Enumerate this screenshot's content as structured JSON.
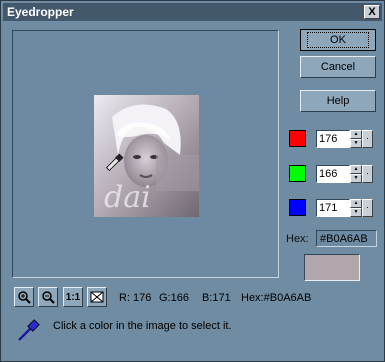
{
  "window": {
    "title": "Eyedropper",
    "close_label": "X"
  },
  "buttons": {
    "ok": "OK",
    "cancel": "Cancel",
    "help": "Help"
  },
  "channels": {
    "red": {
      "value": "176",
      "swatch_color": "#ff0000"
    },
    "green": {
      "value": "166",
      "swatch_color": "#00ff00"
    },
    "blue": {
      "value": "171",
      "swatch_color": "#0000ff"
    }
  },
  "hex": {
    "label": "Hex:",
    "value": "#B0A6AB"
  },
  "selected_color": "#b0a6ab",
  "toolbar": {
    "fit_label": "1:1",
    "icons": [
      "zoom-in-icon",
      "zoom-out-icon",
      "actual-size",
      "fit-window-icon"
    ]
  },
  "readout": {
    "r": "R: 176",
    "g": "G:166",
    "b": "B:171",
    "hex": "Hex:#B0A6AB"
  },
  "instruction": "Click a color in the image to select it."
}
